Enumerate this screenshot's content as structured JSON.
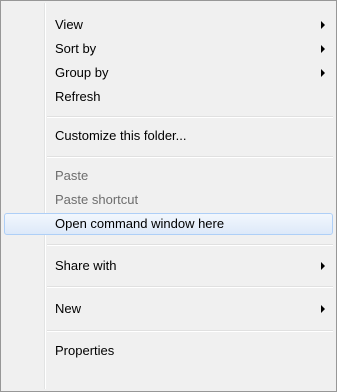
{
  "menu": {
    "view": "View",
    "sort_by": "Sort by",
    "group_by": "Group by",
    "refresh": "Refresh",
    "customize": "Customize this folder...",
    "paste": "Paste",
    "paste_shortcut": "Paste shortcut",
    "open_command_window": "Open command window here",
    "share_with": "Share with",
    "new": "New",
    "properties": "Properties"
  },
  "state": {
    "highlighted_item": "open_command_window",
    "disabled_items": [
      "paste",
      "paste_shortcut"
    ]
  },
  "colors": {
    "menu_background": "#f0f0f0",
    "menu_border": "#979797",
    "highlight_border": "#aecff7",
    "disabled_text": "#6d6d6d"
  }
}
